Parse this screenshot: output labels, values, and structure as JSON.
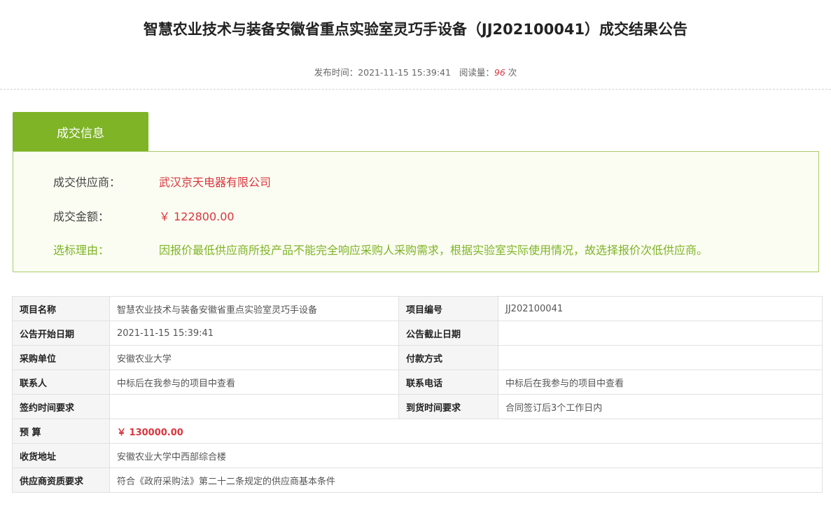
{
  "page": {
    "title": "智慧农业技术与装备安徽省重点实验室灵巧手设备（JJ202100041）成交结果公告",
    "meta": {
      "publish_label": "发布时间：",
      "publish_time": "2021-11-15 15:39:41",
      "read_label": "阅读量：",
      "read_count": "96",
      "read_unit": "次"
    }
  },
  "deal": {
    "tab_label": "成交信息",
    "supplier_label": "成交供应商：",
    "supplier": "武汉京天电器有限公司",
    "amount_label": "成交金额：",
    "amount": "￥ 122800.00",
    "reason_label": "选标理由：",
    "reason": "因报价最低供应商所投产品不能完全响应采购人采购需求，根据实验室实际使用情况，故选择报价次低供应商。"
  },
  "details": {
    "project_name_label": "项目名称",
    "project_name": "智慧农业技术与装备安徽省重点实验室灵巧手设备",
    "project_no_label": "项目编号",
    "project_no": "JJ202100041",
    "start_date_label": "公告开始日期",
    "start_date": "2021-11-15 15:39:41",
    "end_date_label": "公告截止日期",
    "end_date": "",
    "buyer_label": "采购单位",
    "buyer": "安徽农业大学",
    "payment_label": "付款方式",
    "payment": "",
    "contact_label": "联系人",
    "contact": "中标后在我参与的项目中查看",
    "phone_label": "联系电话",
    "phone": "中标后在我参与的项目中查看",
    "sign_time_label": "签约时间要求",
    "sign_time": "",
    "delivery_time_label": "到货时间要求",
    "delivery_time": "合同签订后3个工作日内",
    "budget_label": "预 算",
    "budget": "￥ 130000.00",
    "address_label": "收货地址",
    "address": "安徽农业大学中西部综合楼",
    "qualification_label": "供应商资质要求",
    "qualification": "符合《政府采购法》第二十二条规定的供应商基本条件"
  }
}
